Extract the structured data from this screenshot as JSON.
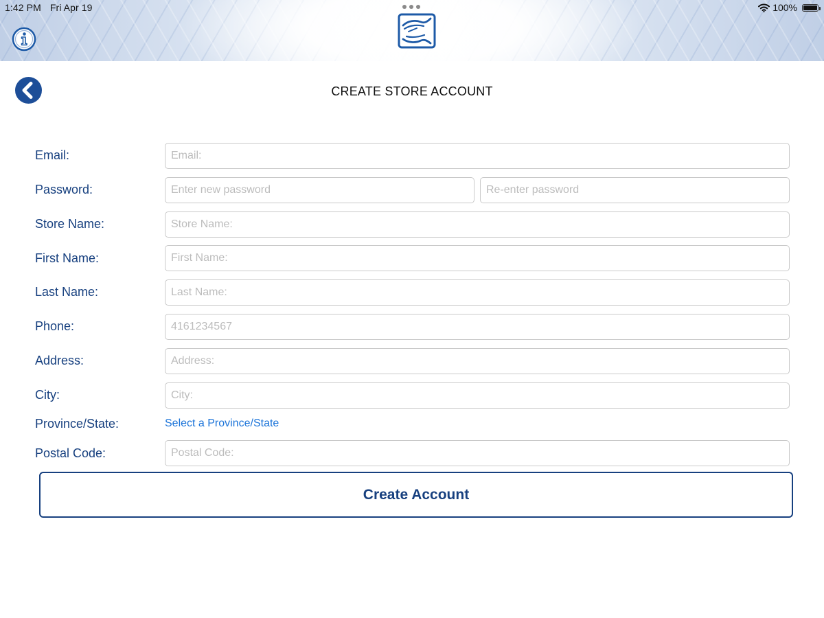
{
  "status_bar": {
    "time": "1:42 PM",
    "date": "Fri Apr 19",
    "battery": "100%",
    "battery_level": 1.0
  },
  "header": {
    "title": "CREATE STORE ACCOUNT"
  },
  "form": {
    "email": {
      "label": "Email:",
      "placeholder": "Email:"
    },
    "password": {
      "label": "Password:",
      "placeholder": "Enter new password",
      "confirm_placeholder": "Re-enter password"
    },
    "store_name": {
      "label": "Store Name:",
      "placeholder": "Store Name:"
    },
    "first_name": {
      "label": "First Name:",
      "placeholder": "First Name:"
    },
    "last_name": {
      "label": "Last Name:",
      "placeholder": "Last Name:"
    },
    "phone": {
      "label": "Phone:",
      "placeholder": "4161234567"
    },
    "address": {
      "label": "Address:",
      "placeholder": "Address:"
    },
    "city": {
      "label": "City:",
      "placeholder": "City:"
    },
    "province": {
      "label": "Province/State:",
      "link": "Select a Province/State"
    },
    "postal_code": {
      "label": "Postal Code:",
      "placeholder": "Postal Code:"
    }
  },
  "actions": {
    "create_label": "Create Account"
  },
  "icons": {
    "back": "chevron-left-icon",
    "info": "info-icon",
    "logo": "hands-logo-icon",
    "wifi": "wifi-icon",
    "battery": "battery-icon"
  },
  "colors": {
    "primary": "#17407f",
    "link": "#1a73d9",
    "placeholder": "#bcbcbc",
    "border": "#c9c9c9"
  }
}
